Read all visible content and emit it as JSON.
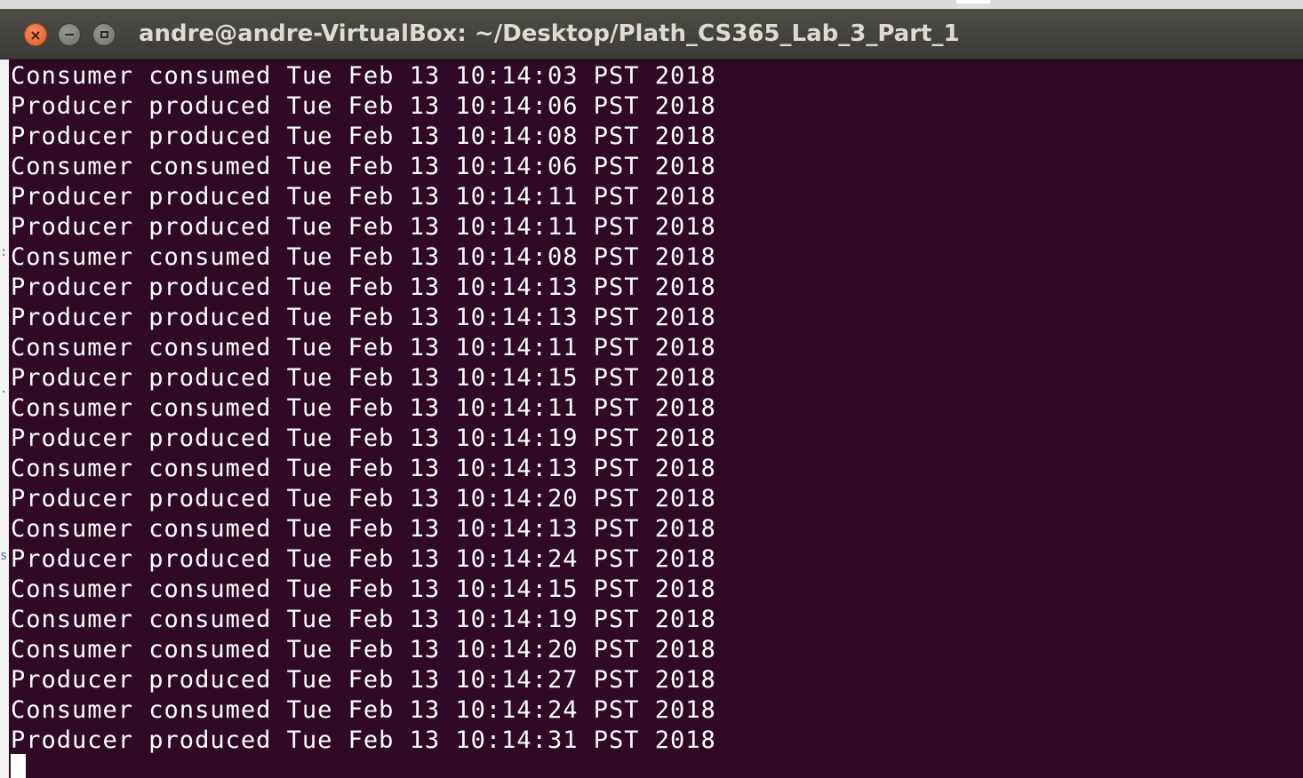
{
  "window": {
    "title": "andre@andre-VirtualBox: ~/Desktop/Plath_CS365_Lab_3_Part_1",
    "buttons": {
      "close_icon": "close-icon",
      "minimize_icon": "minimize-icon",
      "maximize_icon": "maximize-icon"
    }
  },
  "colors": {
    "terminal_background": "#300a24",
    "terminal_text": "#ffffff",
    "titlebar": "#3c3b37",
    "close_button": "#e05a26"
  },
  "terminal": {
    "lines": [
      "Consumer consumed Tue Feb 13 10:14:03 PST 2018",
      "Producer produced Tue Feb 13 10:14:06 PST 2018",
      "Producer produced Tue Feb 13 10:14:08 PST 2018",
      "Consumer consumed Tue Feb 13 10:14:06 PST 2018",
      "Producer produced Tue Feb 13 10:14:11 PST 2018",
      "Producer produced Tue Feb 13 10:14:11 PST 2018",
      "Consumer consumed Tue Feb 13 10:14:08 PST 2018",
      "Producer produced Tue Feb 13 10:14:13 PST 2018",
      "Producer produced Tue Feb 13 10:14:13 PST 2018",
      "Consumer consumed Tue Feb 13 10:14:11 PST 2018",
      "Producer produced Tue Feb 13 10:14:15 PST 2018",
      "Consumer consumed Tue Feb 13 10:14:11 PST 2018",
      "Producer produced Tue Feb 13 10:14:19 PST 2018",
      "Consumer consumed Tue Feb 13 10:14:13 PST 2018",
      "Producer produced Tue Feb 13 10:14:20 PST 2018",
      "Consumer consumed Tue Feb 13 10:14:13 PST 2018",
      "Producer produced Tue Feb 13 10:14:24 PST 2018",
      "Consumer consumed Tue Feb 13 10:14:15 PST 2018",
      "Consumer consumed Tue Feb 13 10:14:19 PST 2018",
      "Consumer consumed Tue Feb 13 10:14:20 PST 2018",
      "Producer produced Tue Feb 13 10:14:27 PST 2018",
      "Consumer consumed Tue Feb 13 10:14:24 PST 2018",
      "Producer produced Tue Feb 13 10:14:31 PST 2018"
    ]
  }
}
